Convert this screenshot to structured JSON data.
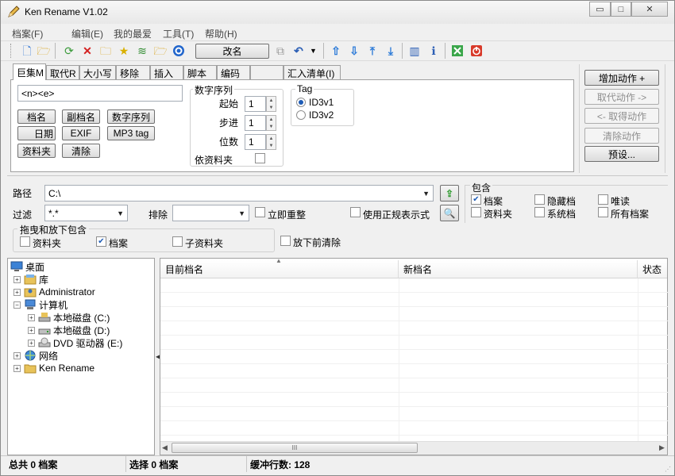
{
  "window": {
    "title": "Ken Rename V1.02",
    "minimize": "▭",
    "maximize": "□",
    "close": "✕"
  },
  "menu": [
    "档案(F)",
    "编辑(E)",
    "我的最爱",
    "工具(T)",
    "帮助(H)"
  ],
  "toolbar": {
    "rename_button": "改名"
  },
  "tabs": [
    "巨集M",
    "取代R",
    "大小写",
    "移除",
    "插入",
    "脚本",
    "编码",
    "",
    "汇入清单(I)"
  ],
  "macro": {
    "pattern_value": "<n><e>",
    "buttons": [
      "档名",
      "副档名",
      "数字序列",
      "日期",
      "EXIF",
      "MP3 tag",
      "资料夹",
      "清除"
    ]
  },
  "number_seq": {
    "title": "数字序列",
    "start_label": "起始",
    "start_value": "1",
    "step_label": "步进",
    "step_value": "1",
    "digits_label": "位数",
    "digits_value": "1",
    "by_folder_label": "依资料夹"
  },
  "tag": {
    "title": "Tag",
    "options": [
      "ID3v1",
      "ID3v2"
    ],
    "selected": "ID3v1"
  },
  "actions": [
    "增加动作 +",
    "取代动作 ->",
    "<- 取得动作",
    "清除动作",
    "预设..."
  ],
  "path": {
    "label": "路径",
    "value": "C:\\"
  },
  "filter": {
    "label": "过滤",
    "value": "*.*",
    "exclude_label": "排除",
    "exclude_value": "",
    "immediate_label": "立即重整",
    "regex_label": "使用正规表示式"
  },
  "include": {
    "title": "包含",
    "items": [
      {
        "label": "档案",
        "checked": true
      },
      {
        "label": "隐藏档",
        "checked": false
      },
      {
        "label": "唯读",
        "checked": false
      },
      {
        "label": "资料夹",
        "checked": false
      },
      {
        "label": "系统档",
        "checked": false
      },
      {
        "label": "所有档案",
        "checked": false
      }
    ]
  },
  "dragdrop": {
    "title": "拖曳和放下包含",
    "folder_label": "资料夹",
    "folder_checked": false,
    "file_label": "档案",
    "file_checked": true,
    "subfolder_label": "子资料夹",
    "subfolder_checked": false,
    "clear_label": "放下前清除",
    "clear_checked": false
  },
  "tree": [
    "桌面",
    "库",
    "Administrator",
    "计算机",
    "本地磁盘 (C:)",
    "本地磁盘 (D:)",
    "DVD 驱动器 (E:)",
    "网络",
    "Ken Rename"
  ],
  "file_list": {
    "columns": [
      "目前档名",
      "新档名",
      "状态"
    ],
    "rows": []
  },
  "scrollbar": {
    "thumb": "III",
    "left": "◀",
    "right": "▶"
  },
  "status": {
    "total": "总共 0 档案",
    "selected": "选择 0 档案",
    "buffer": "缓冲行数: 128"
  },
  "colors": {
    "check_mark": "#1d5bb5",
    "window_bg": "#f0f0f0"
  }
}
